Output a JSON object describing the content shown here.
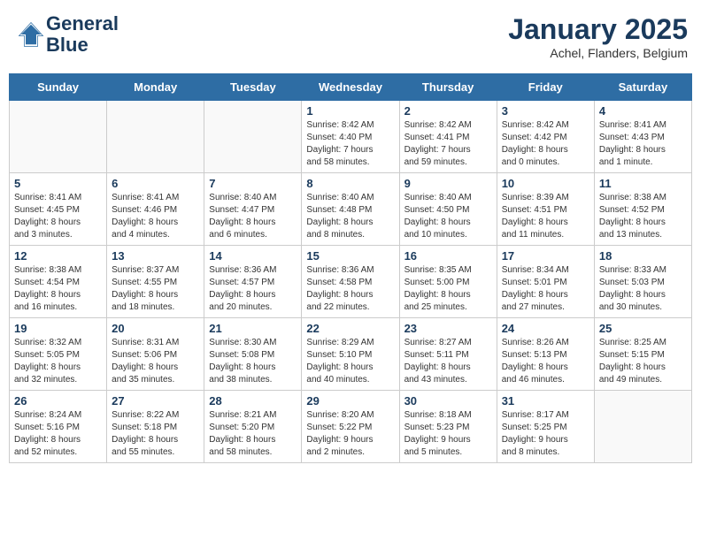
{
  "header": {
    "logo_line1": "General",
    "logo_line2": "Blue",
    "month": "January 2025",
    "location": "Achel, Flanders, Belgium"
  },
  "weekdays": [
    "Sunday",
    "Monday",
    "Tuesday",
    "Wednesday",
    "Thursday",
    "Friday",
    "Saturday"
  ],
  "weeks": [
    [
      {
        "day": "",
        "empty": true
      },
      {
        "day": "",
        "empty": true
      },
      {
        "day": "",
        "empty": true
      },
      {
        "day": "1",
        "info": "Sunrise: 8:42 AM\nSunset: 4:40 PM\nDaylight: 7 hours\nand 58 minutes."
      },
      {
        "day": "2",
        "info": "Sunrise: 8:42 AM\nSunset: 4:41 PM\nDaylight: 7 hours\nand 59 minutes."
      },
      {
        "day": "3",
        "info": "Sunrise: 8:42 AM\nSunset: 4:42 PM\nDaylight: 8 hours\nand 0 minutes."
      },
      {
        "day": "4",
        "info": "Sunrise: 8:41 AM\nSunset: 4:43 PM\nDaylight: 8 hours\nand 1 minute."
      }
    ],
    [
      {
        "day": "5",
        "info": "Sunrise: 8:41 AM\nSunset: 4:45 PM\nDaylight: 8 hours\nand 3 minutes."
      },
      {
        "day": "6",
        "info": "Sunrise: 8:41 AM\nSunset: 4:46 PM\nDaylight: 8 hours\nand 4 minutes."
      },
      {
        "day": "7",
        "info": "Sunrise: 8:40 AM\nSunset: 4:47 PM\nDaylight: 8 hours\nand 6 minutes."
      },
      {
        "day": "8",
        "info": "Sunrise: 8:40 AM\nSunset: 4:48 PM\nDaylight: 8 hours\nand 8 minutes."
      },
      {
        "day": "9",
        "info": "Sunrise: 8:40 AM\nSunset: 4:50 PM\nDaylight: 8 hours\nand 10 minutes."
      },
      {
        "day": "10",
        "info": "Sunrise: 8:39 AM\nSunset: 4:51 PM\nDaylight: 8 hours\nand 11 minutes."
      },
      {
        "day": "11",
        "info": "Sunrise: 8:38 AM\nSunset: 4:52 PM\nDaylight: 8 hours\nand 13 minutes."
      }
    ],
    [
      {
        "day": "12",
        "info": "Sunrise: 8:38 AM\nSunset: 4:54 PM\nDaylight: 8 hours\nand 16 minutes."
      },
      {
        "day": "13",
        "info": "Sunrise: 8:37 AM\nSunset: 4:55 PM\nDaylight: 8 hours\nand 18 minutes."
      },
      {
        "day": "14",
        "info": "Sunrise: 8:36 AM\nSunset: 4:57 PM\nDaylight: 8 hours\nand 20 minutes."
      },
      {
        "day": "15",
        "info": "Sunrise: 8:36 AM\nSunset: 4:58 PM\nDaylight: 8 hours\nand 22 minutes."
      },
      {
        "day": "16",
        "info": "Sunrise: 8:35 AM\nSunset: 5:00 PM\nDaylight: 8 hours\nand 25 minutes."
      },
      {
        "day": "17",
        "info": "Sunrise: 8:34 AM\nSunset: 5:01 PM\nDaylight: 8 hours\nand 27 minutes."
      },
      {
        "day": "18",
        "info": "Sunrise: 8:33 AM\nSunset: 5:03 PM\nDaylight: 8 hours\nand 30 minutes."
      }
    ],
    [
      {
        "day": "19",
        "info": "Sunrise: 8:32 AM\nSunset: 5:05 PM\nDaylight: 8 hours\nand 32 minutes."
      },
      {
        "day": "20",
        "info": "Sunrise: 8:31 AM\nSunset: 5:06 PM\nDaylight: 8 hours\nand 35 minutes."
      },
      {
        "day": "21",
        "info": "Sunrise: 8:30 AM\nSunset: 5:08 PM\nDaylight: 8 hours\nand 38 minutes."
      },
      {
        "day": "22",
        "info": "Sunrise: 8:29 AM\nSunset: 5:10 PM\nDaylight: 8 hours\nand 40 minutes."
      },
      {
        "day": "23",
        "info": "Sunrise: 8:27 AM\nSunset: 5:11 PM\nDaylight: 8 hours\nand 43 minutes."
      },
      {
        "day": "24",
        "info": "Sunrise: 8:26 AM\nSunset: 5:13 PM\nDaylight: 8 hours\nand 46 minutes."
      },
      {
        "day": "25",
        "info": "Sunrise: 8:25 AM\nSunset: 5:15 PM\nDaylight: 8 hours\nand 49 minutes."
      }
    ],
    [
      {
        "day": "26",
        "info": "Sunrise: 8:24 AM\nSunset: 5:16 PM\nDaylight: 8 hours\nand 52 minutes."
      },
      {
        "day": "27",
        "info": "Sunrise: 8:22 AM\nSunset: 5:18 PM\nDaylight: 8 hours\nand 55 minutes."
      },
      {
        "day": "28",
        "info": "Sunrise: 8:21 AM\nSunset: 5:20 PM\nDaylight: 8 hours\nand 58 minutes."
      },
      {
        "day": "29",
        "info": "Sunrise: 8:20 AM\nSunset: 5:22 PM\nDaylight: 9 hours\nand 2 minutes."
      },
      {
        "day": "30",
        "info": "Sunrise: 8:18 AM\nSunset: 5:23 PM\nDaylight: 9 hours\nand 5 minutes."
      },
      {
        "day": "31",
        "info": "Sunrise: 8:17 AM\nSunset: 5:25 PM\nDaylight: 9 hours\nand 8 minutes."
      },
      {
        "day": "",
        "empty": true
      }
    ]
  ]
}
